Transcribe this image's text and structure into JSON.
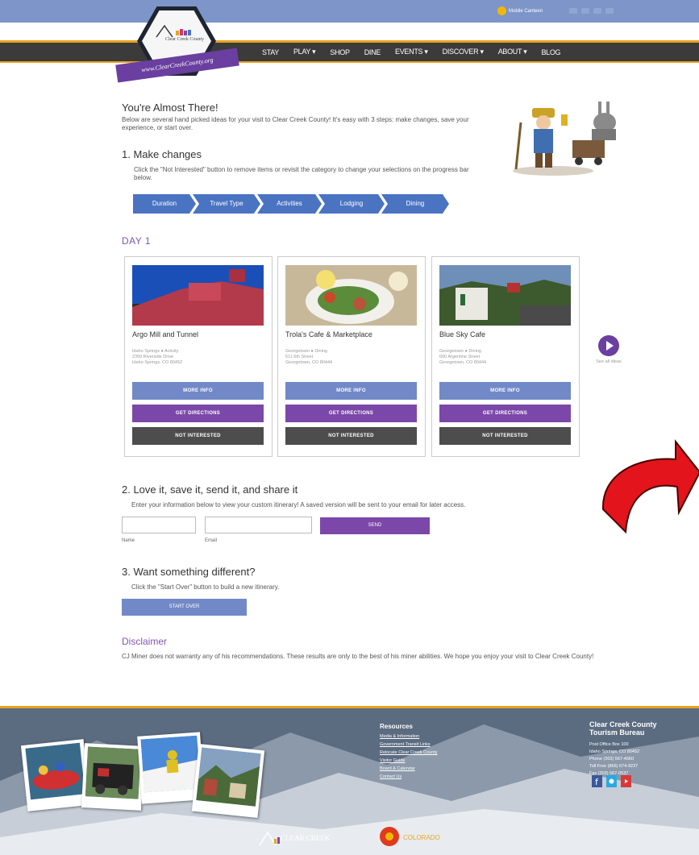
{
  "header": {
    "mobile_label": "Mobile Canteen",
    "logo_name": "Clear Creek County",
    "logo_ribbon": "www.ClearCreekCounty.org"
  },
  "nav": {
    "items": [
      "STAY",
      "PLAY ▾",
      "SHOP",
      "DINE",
      "EVENTS ▾",
      "DISCOVER ▾",
      "ABOUT ▾",
      "BLOG"
    ]
  },
  "intro": {
    "title": "You're Almost There!",
    "text": "Below are several hand picked ideas for your visit to Clear Creek County! It's easy with 3 steps: make changes, save your experience, or start over."
  },
  "step1": {
    "title": "1. Make changes",
    "text": "Click the \"Not Interested\" button to remove items or revisit the category to change your selections on the progress bar below."
  },
  "progress": [
    "Duration",
    "Travel Type",
    "Activities",
    "Lodging",
    "Dining"
  ],
  "day": {
    "title": "DAY 1"
  },
  "cards": [
    {
      "title": "Argo Mill and Tunnel",
      "addr1": "Idaho Springs ● Activity",
      "addr2": "2350 Riverside Drive",
      "addr3": "Idaho Springs, CO 80452",
      "more": "MORE INFO",
      "dir": "GET DIRECTIONS",
      "not": "NOT INTERESTED"
    },
    {
      "title": "Trola's Cafe & Marketplace",
      "addr1": "Georgetown ● Dining",
      "addr2": "511 6th Street",
      "addr3": "Georgetown, CO 80444",
      "more": "MORE INFO",
      "dir": "GET DIRECTIONS",
      "not": "NOT INTERESTED"
    },
    {
      "title": "Blue Sky Cafe",
      "addr1": "Georgetown ● Dining",
      "addr2": "600 Argentine Street",
      "addr3": "Georgetown, CO 80444",
      "more": "MORE INFO",
      "dir": "GET DIRECTIONS",
      "not": "NOT INTERESTED"
    }
  ],
  "next": {
    "label": "See all ideas"
  },
  "step2": {
    "title": "2. Love it, save it, send it, and share it",
    "text": "Enter your information below to view your custom itinerary! A saved version will be sent to your email for later access.",
    "name_label": "Name",
    "email_label": "Email",
    "submit": "SEND"
  },
  "step3": {
    "title": "3. Want something different?",
    "text": "Click the \"Start Over\" button to build a new itinerary.",
    "button": "START OVER"
  },
  "disclaimer": {
    "title": "Disclaimer",
    "text": "CJ Miner does not warranty any of his recommendations. These results are only to the best of his miner abilities. We hope you enjoy your visit to Clear Creek County!"
  },
  "footer": {
    "resources_title": "Resources",
    "resources": [
      "Media & Information",
      "Government Transit Links",
      "Relocate Clear Creek County",
      "Visitor Guide",
      "Board & Calendar",
      "Contact Us"
    ],
    "bureau_title": "Clear Creek County Tourism Bureau",
    "bureau_lines": [
      "Post Office Box 100",
      "Idaho Springs, CO 80452",
      "Phone (303) 567-4660",
      "Toll Free (866) 674-9237",
      "Fax (303) 567-0537"
    ],
    "logo_text": "CLEAR CREEK",
    "partner_text": "COLORADO"
  },
  "colors": {
    "nav_bg": "#3b3b3b",
    "accent_orange": "#e8a31f",
    "primary_blue": "#4a74c2",
    "button_blue": "#7289c7",
    "button_purple": "#7b48a9",
    "button_dark": "#4d4d4d",
    "heading_purple": "#7e57b0",
    "arrow_red": "#e3141b"
  }
}
